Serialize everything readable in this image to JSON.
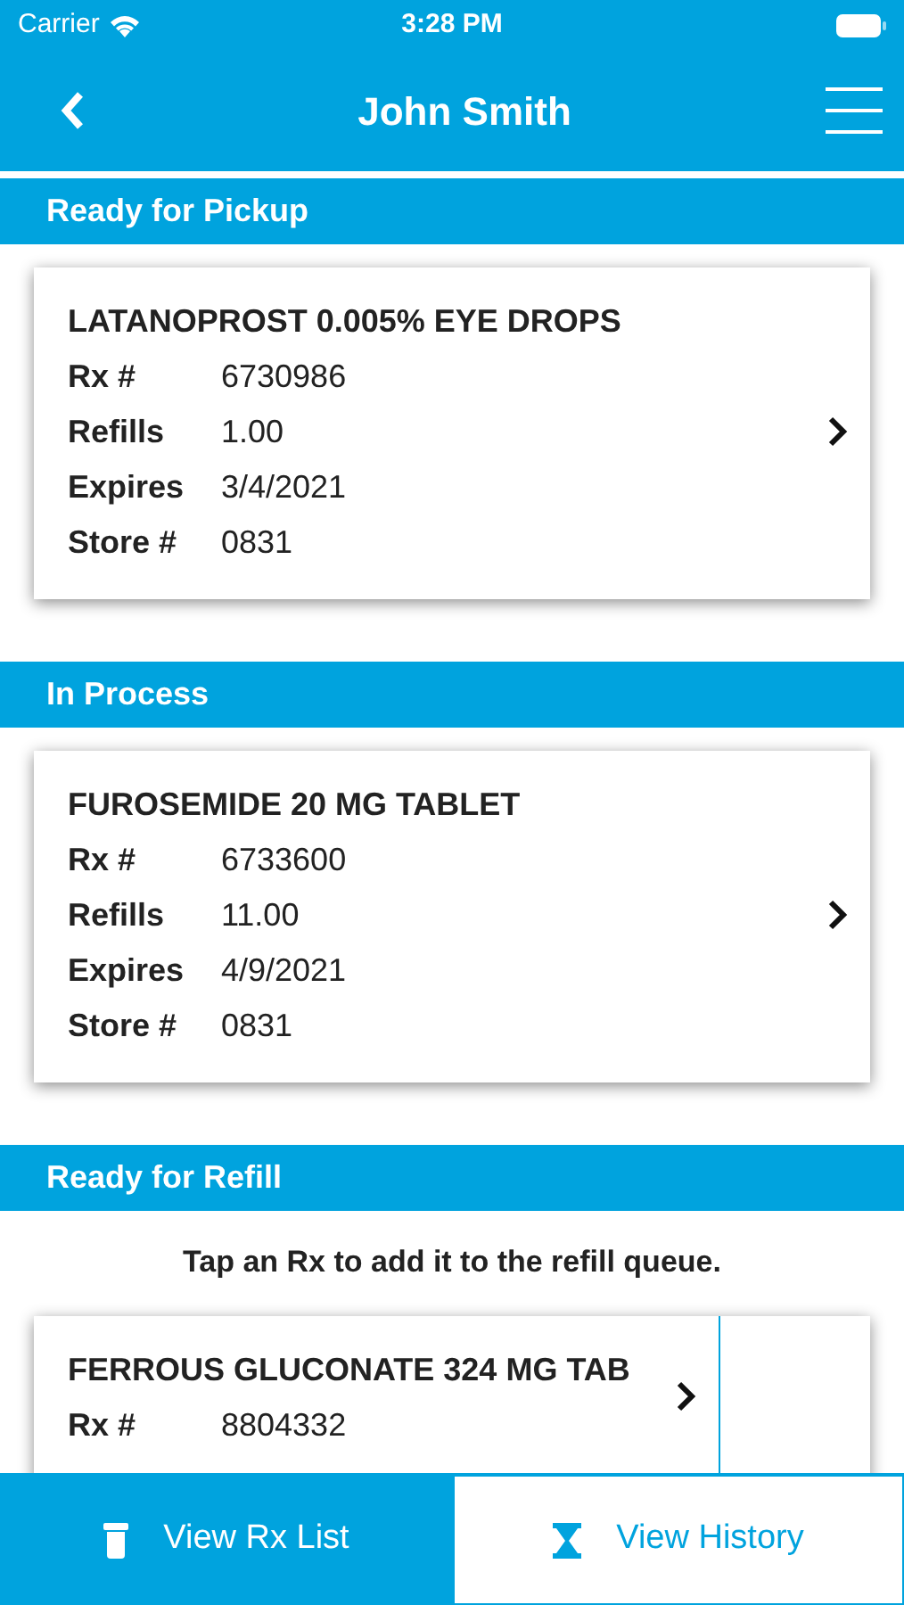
{
  "status_bar": {
    "carrier": "Carrier",
    "time": "3:28 PM"
  },
  "nav": {
    "title": "John Smith"
  },
  "sections": [
    {
      "title": "Ready for Pickup",
      "cards": [
        {
          "kind": "detail",
          "name": "LATANOPROST 0.005% EYE DROPS",
          "fields": [
            {
              "label": "Rx #",
              "value": "6730986"
            },
            {
              "label": "Refills",
              "value": "1.00"
            },
            {
              "label": "Expires",
              "value": "3/4/2021"
            },
            {
              "label": "Store #",
              "value": "0831"
            }
          ]
        }
      ]
    },
    {
      "title": "In Process",
      "cards": [
        {
          "kind": "detail",
          "name": "FUROSEMIDE 20 MG TABLET",
          "fields": [
            {
              "label": "Rx #",
              "value": "6733600"
            },
            {
              "label": "Refills",
              "value": "11.00"
            },
            {
              "label": "Expires",
              "value": "4/9/2021"
            },
            {
              "label": "Store #",
              "value": "0831"
            }
          ]
        }
      ]
    },
    {
      "title": "Ready for Refill",
      "instruction": "Tap an Rx to add it to the refill queue.",
      "cards": [
        {
          "kind": "refill",
          "name": "FERROUS GLUCONATE 324 MG TAB",
          "fields": [
            {
              "label": "Rx #",
              "value": "8804332"
            }
          ]
        }
      ]
    }
  ],
  "tabs": [
    {
      "label": "View Rx List",
      "kind": "bottle",
      "selected": true
    },
    {
      "label": "View History",
      "kind": "hourglass",
      "selected": false
    }
  ]
}
